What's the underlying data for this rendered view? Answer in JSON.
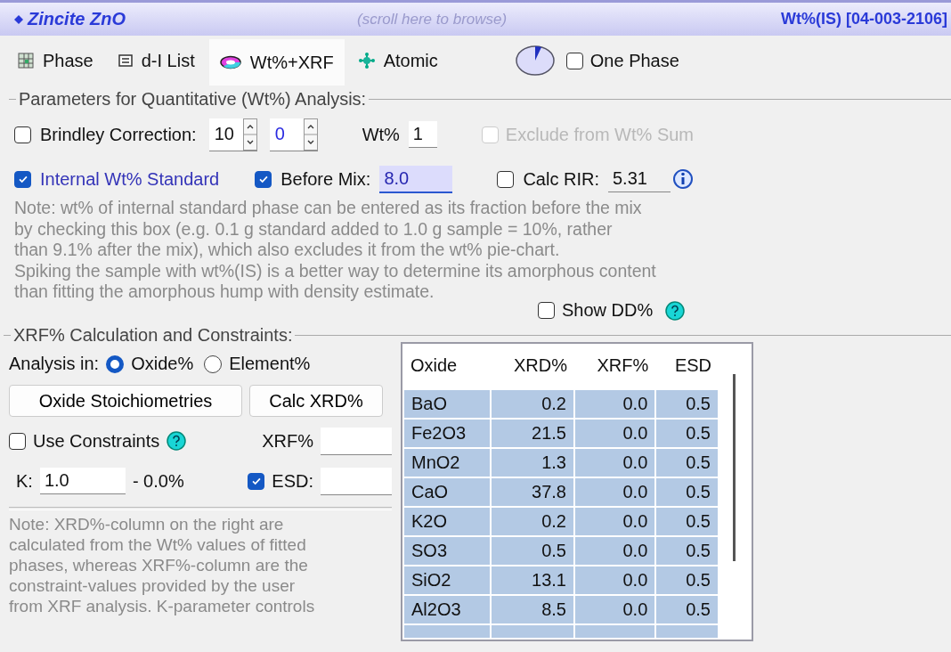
{
  "header": {
    "title": "Zincite ZnO",
    "hint": "(scroll here to browse)",
    "reference": "Wt%(IS) [04-003-2106]"
  },
  "tabs": [
    {
      "label": "Phase",
      "selected": false
    },
    {
      "label": "d-I List",
      "selected": false
    },
    {
      "label": "Wt%+XRF",
      "selected": true
    },
    {
      "label": "Atomic",
      "selected": false
    }
  ],
  "one_phase": {
    "label": "One Phase",
    "checked": false
  },
  "quant_group": {
    "title": "Parameters for Quantitative (Wt%) Analysis:",
    "brindley": {
      "label": "Brindley Correction:",
      "checked": false,
      "value_1": "10",
      "value_2": "0"
    },
    "wt": {
      "label": "Wt%",
      "value": "1"
    },
    "exclude": {
      "label": "Exclude from Wt% Sum",
      "checked": false,
      "disabled": true
    },
    "internal_standard": {
      "label": "Internal Wt% Standard",
      "checked": true
    },
    "before_mix": {
      "label": "Before Mix:",
      "checked": true,
      "value": "8.0"
    },
    "calc_rir": {
      "label": "Calc RIR:",
      "checked": false,
      "value": "5.31"
    },
    "note": "Note: wt% of internal standard phase can be entered as its fraction before the mix\nby checking this box (e.g. 0.1 g standard added to 1.0 g sample = 10%, rather\nthan 9.1% after the mix), which also excludes it from the wt% pie-chart.\nSpiking the sample with wt%(IS) is a better way to determine its amorphous content\nthan fitting the amorphous hump with density estimate.",
    "show_dd": {
      "label": "Show DD%",
      "checked": false
    }
  },
  "xrf_group": {
    "title": "XRF% Calculation and Constraints:",
    "analysis_label": "Analysis in:",
    "modes": [
      {
        "label": "Oxide%",
        "selected": true
      },
      {
        "label": "Element%",
        "selected": false
      }
    ],
    "buttons": [
      "Oxide Stoichiometries",
      "Calc XRD%"
    ],
    "use_constraints": {
      "label": "Use Constraints",
      "checked": false
    },
    "xrf_field": {
      "label": "XRF%"
    },
    "k": {
      "label": "K:",
      "value": "1.0",
      "reading": "- 0.0%"
    },
    "esd": {
      "label": "ESD:",
      "checked": true
    },
    "note": "Note: XRD%-column on the right are\ncalculated from the Wt% values of fitted\nphases, whereas XRF%-column are the\nconstraint-values provided by the user\nfrom XRF analysis. K-parameter controls"
  },
  "table": {
    "columns": [
      "Oxide",
      "XRD%",
      "XRF%",
      "ESD"
    ],
    "rows": [
      {
        "cells": [
          "BaO",
          "0.2",
          "0.0",
          "0.5"
        ],
        "selected": true
      },
      {
        "cells": [
          "Fe2O3",
          "21.5",
          "0.0",
          "0.5"
        ],
        "selected": true
      },
      {
        "cells": [
          "MnO2",
          "1.3",
          "0.0",
          "0.5"
        ],
        "selected": true
      },
      {
        "cells": [
          "CaO",
          "37.8",
          "0.0",
          "0.5"
        ],
        "selected": true
      },
      {
        "cells": [
          "K2O",
          "0.2",
          "0.0",
          "0.5"
        ],
        "selected": true
      },
      {
        "cells": [
          "SO3",
          "0.5",
          "0.0",
          "0.5"
        ],
        "selected": true
      },
      {
        "cells": [
          "SiO2",
          "13.1",
          "0.0",
          "0.5"
        ],
        "selected": true
      },
      {
        "cells": [
          "Al2O3",
          "8.5",
          "0.0",
          "0.5"
        ],
        "selected": true
      }
    ]
  }
}
